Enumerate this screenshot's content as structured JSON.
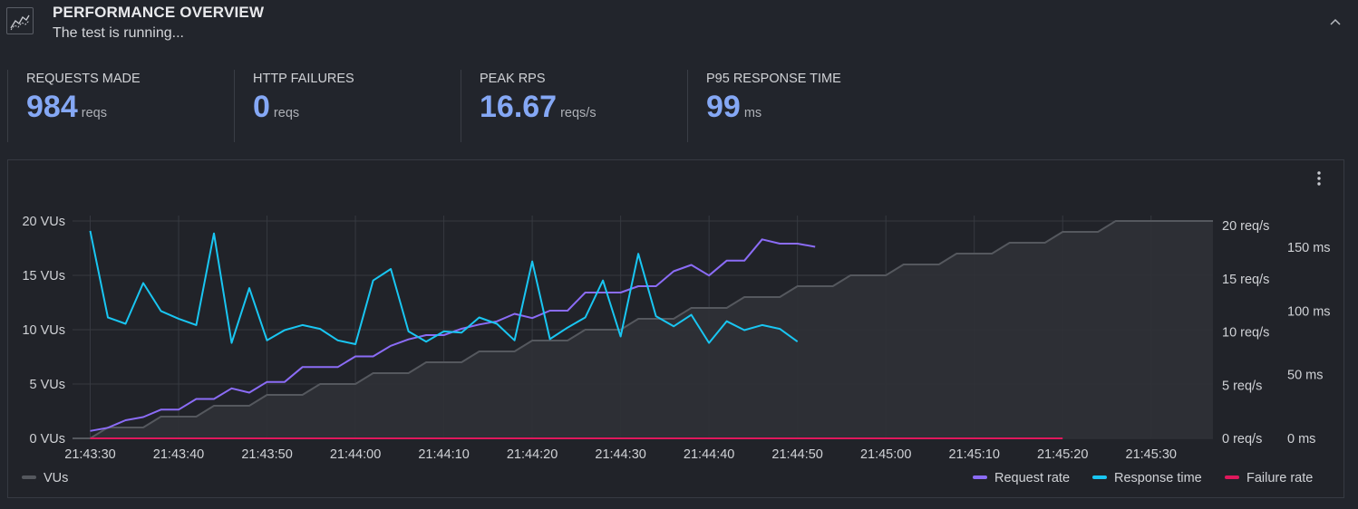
{
  "header": {
    "title": "PERFORMANCE OVERVIEW",
    "subtitle": "The test is running...",
    "icon": "chart-line-icon",
    "collapse_icon": "chevron-up-icon"
  },
  "stats": [
    {
      "label": "REQUESTS MADE",
      "value": "984",
      "unit": "reqs"
    },
    {
      "label": "HTTP FAILURES",
      "value": "0",
      "unit": "reqs"
    },
    {
      "label": "PEAK RPS",
      "value": "16.67",
      "unit": "reqs/s"
    },
    {
      "label": "P95 RESPONSE TIME",
      "value": "99",
      "unit": "ms"
    }
  ],
  "colors": {
    "vus": "#55585e",
    "vus_fill": "#2f3136",
    "request_rate": "#8b6cf6",
    "response_time": "#19c6f2",
    "failure_rate": "#e0185c",
    "stat_value": "#85a8f5"
  },
  "panel": {
    "menu_icon": "kebab-menu-icon"
  },
  "chart_data": {
    "type": "line",
    "x_ticks": [
      "21:43:30",
      "21:43:40",
      "21:43:50",
      "21:44:00",
      "21:44:10",
      "21:44:20",
      "21:44:30",
      "21:44:40",
      "21:44:50",
      "21:45:00",
      "21:45:10",
      "21:45:20",
      "21:45:30"
    ],
    "x_range": [
      "21:43:28",
      "21:45:37"
    ],
    "y_left": {
      "ticks": [
        "0 VUs",
        "5 VUs",
        "10 VUs",
        "15 VUs",
        "20 VUs"
      ],
      "ylim": [
        0,
        20.5
      ]
    },
    "y_right_rate": {
      "ticks": [
        "0 req/s",
        "5 req/s",
        "10 req/s",
        "15 req/s",
        "20 req/s"
      ],
      "ylim": [
        0,
        20
      ]
    },
    "y_right_ms": {
      "ticks": [
        "0 ms",
        "50 ms",
        "100 ms",
        "150 ms"
      ],
      "ylim": [
        0,
        175
      ]
    },
    "legend": {
      "left": [
        "VUs"
      ],
      "right": [
        "Request rate",
        "Response time",
        "Failure rate"
      ]
    },
    "series": [
      {
        "name": "VUs",
        "axis": "vus",
        "kind": "step",
        "points": [
          [
            "21:43:28",
            0
          ],
          [
            "21:43:30",
            0
          ],
          [
            "21:43:32",
            1
          ],
          [
            "21:43:36",
            1
          ],
          [
            "21:43:38",
            2
          ],
          [
            "21:43:42",
            2
          ],
          [
            "21:43:44",
            3
          ],
          [
            "21:43:48",
            3
          ],
          [
            "21:43:50",
            4
          ],
          [
            "21:43:54",
            4
          ],
          [
            "21:43:56",
            5
          ],
          [
            "21:44:00",
            5
          ],
          [
            "21:44:02",
            6
          ],
          [
            "21:44:06",
            6
          ],
          [
            "21:44:08",
            7
          ],
          [
            "21:44:12",
            7
          ],
          [
            "21:44:14",
            8
          ],
          [
            "21:44:18",
            8
          ],
          [
            "21:44:20",
            9
          ],
          [
            "21:44:24",
            9
          ],
          [
            "21:44:26",
            10
          ],
          [
            "21:44:30",
            10
          ],
          [
            "21:44:32",
            11
          ],
          [
            "21:44:36",
            11
          ],
          [
            "21:44:38",
            12
          ],
          [
            "21:44:42",
            12
          ],
          [
            "21:44:44",
            13
          ],
          [
            "21:44:48",
            13
          ],
          [
            "21:44:50",
            14
          ],
          [
            "21:44:54",
            14
          ],
          [
            "21:44:56",
            15
          ],
          [
            "21:45:00",
            15
          ],
          [
            "21:45:02",
            16
          ],
          [
            "21:45:06",
            16
          ],
          [
            "21:45:08",
            17
          ],
          [
            "21:45:12",
            17
          ],
          [
            "21:45:14",
            18
          ],
          [
            "21:45:18",
            18
          ],
          [
            "21:45:20",
            19
          ],
          [
            "21:45:24",
            19
          ],
          [
            "21:45:26",
            20
          ],
          [
            "21:45:30",
            20
          ]
        ]
      },
      {
        "name": "Request rate",
        "axis": "rate",
        "points": [
          [
            "21:43:30",
            0.7
          ],
          [
            "21:43:32",
            1.0
          ],
          [
            "21:43:34",
            1.7
          ],
          [
            "21:43:36",
            2.0
          ],
          [
            "21:43:38",
            2.7
          ],
          [
            "21:43:40",
            2.7
          ],
          [
            "21:43:42",
            3.7
          ],
          [
            "21:43:44",
            3.7
          ],
          [
            "21:43:46",
            4.7
          ],
          [
            "21:43:48",
            4.3
          ],
          [
            "21:43:50",
            5.3
          ],
          [
            "21:43:52",
            5.3
          ],
          [
            "21:43:54",
            6.7
          ],
          [
            "21:43:56",
            6.7
          ],
          [
            "21:43:58",
            6.7
          ],
          [
            "21:44:00",
            7.7
          ],
          [
            "21:44:02",
            7.7
          ],
          [
            "21:44:04",
            8.7
          ],
          [
            "21:44:06",
            9.3
          ],
          [
            "21:44:08",
            9.7
          ],
          [
            "21:44:10",
            9.7
          ],
          [
            "21:44:12",
            10.3
          ],
          [
            "21:44:14",
            10.7
          ],
          [
            "21:44:16",
            11.0
          ],
          [
            "21:44:18",
            11.7
          ],
          [
            "21:44:20",
            11.3
          ],
          [
            "21:44:22",
            12.0
          ],
          [
            "21:44:24",
            12.0
          ],
          [
            "21:44:26",
            13.7
          ],
          [
            "21:44:28",
            13.7
          ],
          [
            "21:44:30",
            13.7
          ],
          [
            "21:44:32",
            14.3
          ],
          [
            "21:44:34",
            14.3
          ],
          [
            "21:44:36",
            15.7
          ],
          [
            "21:44:38",
            16.3
          ],
          [
            "21:44:40",
            15.3
          ],
          [
            "21:44:42",
            16.7
          ],
          [
            "21:44:44",
            16.7
          ],
          [
            "21:44:46",
            18.7
          ],
          [
            "21:44:48",
            18.3
          ],
          [
            "21:44:50",
            18.3
          ],
          [
            "21:44:52",
            18.0
          ]
        ]
      },
      {
        "name": "Response time",
        "axis": "ms",
        "points": [
          [
            "21:43:30",
            163
          ],
          [
            "21:43:32",
            95
          ],
          [
            "21:43:34",
            90
          ],
          [
            "21:43:36",
            122
          ],
          [
            "21:43:38",
            100
          ],
          [
            "21:43:40",
            94
          ],
          [
            "21:43:42",
            89
          ],
          [
            "21:43:44",
            161
          ],
          [
            "21:43:46",
            75
          ],
          [
            "21:43:48",
            118
          ],
          [
            "21:43:50",
            77
          ],
          [
            "21:43:52",
            85
          ],
          [
            "21:43:54",
            89
          ],
          [
            "21:43:56",
            86
          ],
          [
            "21:43:58",
            77
          ],
          [
            "21:44:00",
            74
          ],
          [
            "21:44:02",
            124
          ],
          [
            "21:44:04",
            133
          ],
          [
            "21:44:06",
            84
          ],
          [
            "21:44:08",
            76
          ],
          [
            "21:44:10",
            84
          ],
          [
            "21:44:12",
            83
          ],
          [
            "21:44:14",
            95
          ],
          [
            "21:44:16",
            90
          ],
          [
            "21:44:18",
            77
          ],
          [
            "21:44:20",
            139
          ],
          [
            "21:44:22",
            78
          ],
          [
            "21:44:24",
            87
          ],
          [
            "21:44:26",
            95
          ],
          [
            "21:44:28",
            124
          ],
          [
            "21:44:30",
            80
          ],
          [
            "21:44:32",
            145
          ],
          [
            "21:44:34",
            96
          ],
          [
            "21:44:36",
            88
          ],
          [
            "21:44:38",
            97
          ],
          [
            "21:44:40",
            75
          ],
          [
            "21:44:42",
            92
          ],
          [
            "21:44:44",
            85
          ],
          [
            "21:44:46",
            89
          ],
          [
            "21:44:48",
            86
          ],
          [
            "21:44:50",
            76
          ]
        ]
      },
      {
        "name": "Failure rate",
        "axis": "rate",
        "points": [
          [
            "21:43:30",
            0
          ],
          [
            "21:45:20",
            0
          ]
        ]
      }
    ]
  }
}
